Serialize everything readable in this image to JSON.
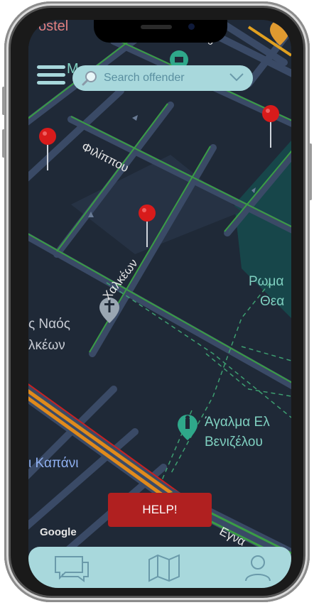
{
  "search": {
    "placeholder": "Search offender"
  },
  "help_button": {
    "label": "HELP!"
  },
  "map": {
    "attribution": "Google",
    "labels": {
      "top_left": "ostel",
      "top_m": "M",
      "street_filippou": "Φιλίππου",
      "street_chalkeon": "Χαλκέων",
      "poi_romaiki_1": "Ρωμα",
      "poi_romaiki_2": "Θεα",
      "poi_naos_1": "ς Ναός",
      "poi_naos_2": "λκέων",
      "poi_agalma_1": "Άγαλμα Ελ",
      "poi_agalma_2": "Βενιζέλου",
      "place_kapani": "ι Καπάνι",
      "street_bottom": "Εγνα",
      "street_top_right": "ου"
    },
    "offender_pins": 3
  },
  "tabs": [
    {
      "name": "chat",
      "icon": "chat-icon"
    },
    {
      "name": "map",
      "icon": "map-icon"
    },
    {
      "name": "profile",
      "icon": "user-icon"
    }
  ],
  "colors": {
    "map_bg": "#1f2937",
    "road": "#3a4a66",
    "accent": "#a8d8dc",
    "help": "#b02020",
    "pin": "#d81b1b",
    "poi": "#7fd0c0"
  }
}
